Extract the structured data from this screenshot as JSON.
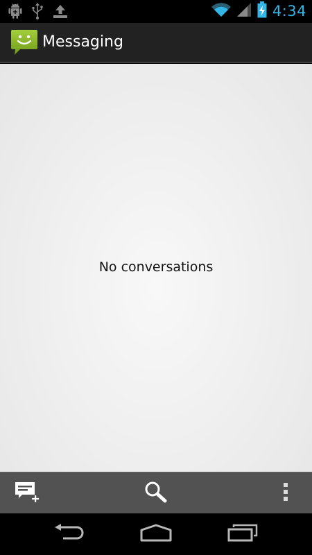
{
  "status_bar": {
    "time": "4:34",
    "clock_color": "#33b5e5",
    "left_icons": [
      "android-debug-icon",
      "usb-icon",
      "upload-icon"
    ],
    "right_icons": [
      "wifi-icon",
      "signal-icon",
      "battery-charging-icon"
    ]
  },
  "action_bar": {
    "title": "Messaging",
    "icon": "messaging-app-icon",
    "icon_color": "#8cbf26"
  },
  "content": {
    "empty_message": "No conversations"
  },
  "bottom_bar": {
    "actions": [
      "new-message-icon",
      "search-icon",
      "overflow-menu-icon"
    ]
  },
  "nav_bar": {
    "buttons": [
      "back-icon",
      "home-icon",
      "recent-apps-icon"
    ]
  }
}
